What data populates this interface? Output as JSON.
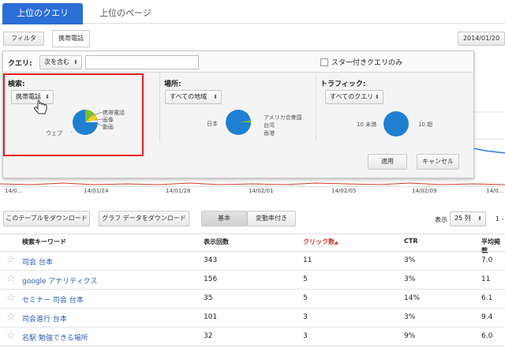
{
  "tabs": {
    "active": "上位のクエリ",
    "inactive": "上位のページ"
  },
  "filter_button": "フィルタ",
  "filter_chip": "携帯電話",
  "date_button": "2014/01/20",
  "query_row": {
    "label": "クエリ:",
    "operator": "次を含む",
    "input_value": "",
    "starred_label": "スター付きクエリのみ"
  },
  "search": {
    "label": "検索:",
    "selected": "携帯電話",
    "legend": [
      "携帯電話",
      "画像",
      "動画"
    ],
    "slice_web": "ウェブ"
  },
  "location": {
    "label": "場所:",
    "selected": "すべての地域",
    "legend": [
      "アメリカ合衆国",
      "台湾",
      "香港"
    ],
    "slice_main": "日本"
  },
  "traffic": {
    "label": "トラフィック:",
    "selected": "すべてのクエリ",
    "left_label": "10 未満",
    "right_label": "10 超"
  },
  "apply_button": "適用",
  "cancel_button": "キャンセル",
  "chart_axis": [
    "14/0...",
    "14/01/24",
    "14/01/28",
    "14/02/01",
    "14/02/05",
    "14/02/09",
    "14/0..."
  ],
  "toolbar": {
    "download_table": "このテーブルをダウンロード",
    "download_chart": "グラフ データをダウンロード",
    "basic": "基本",
    "with_change": "変動率付き",
    "display_label": "表示",
    "rows_value": "25 列",
    "page_indicator": "1 -"
  },
  "table": {
    "headers": [
      "検索キーワード",
      "表示回数",
      "クリック数",
      "CTR",
      "平均掲載"
    ],
    "sort_column": 2,
    "rows": [
      {
        "keyword": "司会 台本",
        "impressions": "343",
        "clicks": "11",
        "ctr": "3%",
        "position": "7.0"
      },
      {
        "keyword": "google アナリティクス",
        "impressions": "156",
        "clicks": "5",
        "ctr": "3%",
        "position": "11"
      },
      {
        "keyword": "セミナー 司会 台本",
        "impressions": "35",
        "clicks": "5",
        "ctr": "14%",
        "position": "6.1"
      },
      {
        "keyword": "司会進行 台本",
        "impressions": "101",
        "clicks": "3",
        "ctr": "3%",
        "position": "9.4"
      },
      {
        "keyword": "名駅 勉強できる場所",
        "impressions": "32",
        "clicks": "3",
        "ctr": "9%",
        "position": "6.0"
      }
    ]
  },
  "colors": {
    "accent": "#2b6fd6",
    "pie_blue": "#1f7fd1",
    "pie_green": "#7bbf2a",
    "pie_yellow": "#f3d11c",
    "sort_red": "#d0302a",
    "highlight": "#e02020"
  }
}
